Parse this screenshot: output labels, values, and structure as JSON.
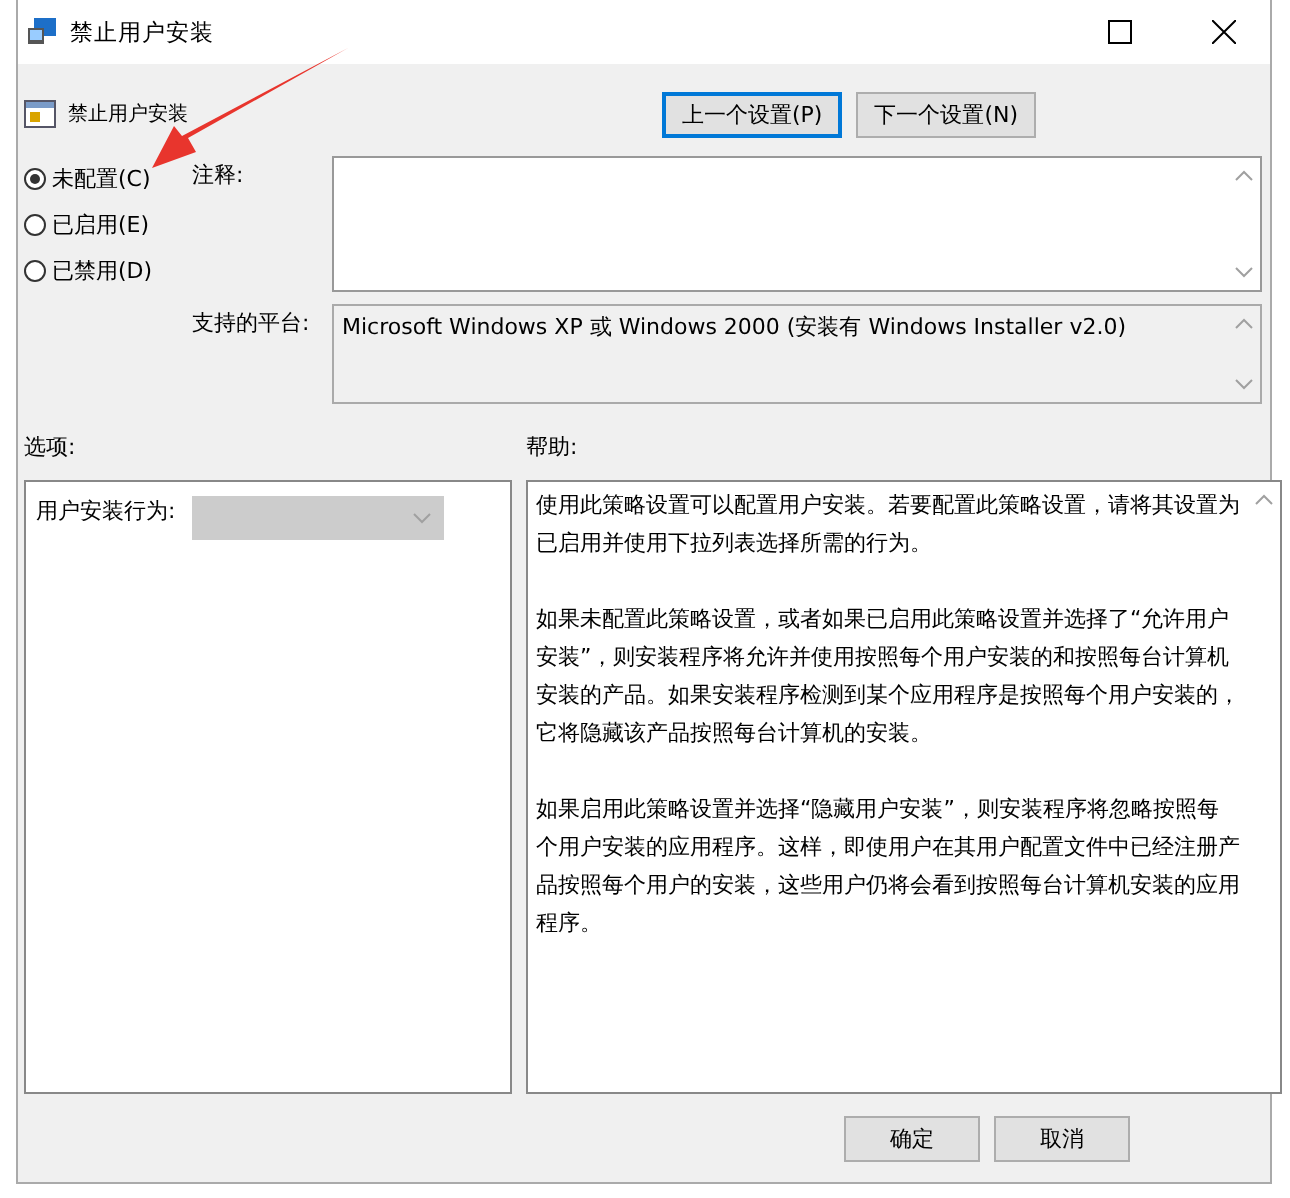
{
  "window": {
    "title": "禁止用户安装"
  },
  "header": {
    "title": "禁止用户安装",
    "prev_button": "上一个设置(P)",
    "next_button": "下一个设置(N)"
  },
  "radios": [
    {
      "label": "未配置(C)",
      "selected": true
    },
    {
      "label": "已启用(E)",
      "selected": false
    },
    {
      "label": "已禁用(D)",
      "selected": false
    }
  ],
  "comment": {
    "label": "注释:"
  },
  "platform": {
    "label": "支持的平台:",
    "value": "Microsoft Windows XP 或 Windows 2000 (安装有 Windows Installer v2.0)"
  },
  "options": {
    "label": "选项:",
    "field_label": "用户安装行为:",
    "dropdown_disabled": true
  },
  "help": {
    "label": "帮助:",
    "paragraphs": [
      "使用此策略设置可以配置用户安装。若要配置此策略设置，请将其设置为已启用并使用下拉列表选择所需的行为。",
      "如果未配置此策略设置，或者如果已启用此策略设置并选择了“允许用户安装”，则安装程序将允许并使用按照每个用户安装的和按照每台计算机安装的产品。如果安装程序检测到某个应用程序是按照每个用户安装的，它将隐藏该产品按照每台计算机的安装。",
      "如果启用此策略设置并选择“隐藏用户安装”，则安装程序将忽略按照每个用户安装的应用程序。这样，即使用户在其用户配置文件中已经注册产品按照每个用户的安装，这些用户仍将会看到按照每台计算机安装的应用程序。"
    ]
  },
  "buttons": [
    "确定",
    "取消"
  ]
}
